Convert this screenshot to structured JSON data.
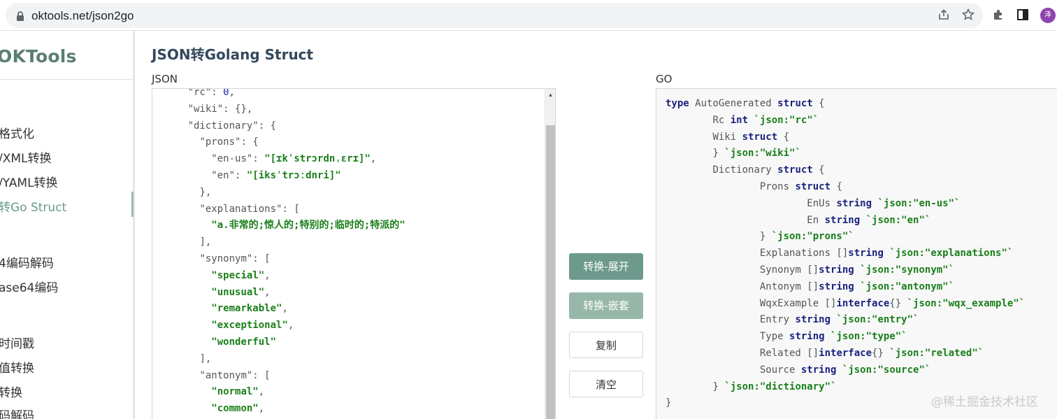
{
  "browser": {
    "url": "oktools.net/json2go",
    "avatar_initial": "泽",
    "icons": [
      "lock-icon",
      "share-icon",
      "star-icon",
      "extensions-icon",
      "sidepanel-icon"
    ]
  },
  "sidebar": {
    "logo": "OKTools",
    "items": [
      {
        "label": "格式化",
        "active": false
      },
      {
        "label": "/XML转换",
        "active": false
      },
      {
        "label": "/YAML转换",
        "active": false
      },
      {
        "label": "转Go Struct",
        "active": true
      },
      {
        "label": "4编码解码",
        "active": false
      },
      {
        "label": "ase64编码",
        "active": false
      },
      {
        "label": "时间戳",
        "active": false
      },
      {
        "label": "值转换",
        "active": false
      },
      {
        "label": "转换",
        "active": false
      },
      {
        "label": "码解码",
        "active": false
      }
    ]
  },
  "main": {
    "title": "JSON转Golang Struct",
    "json_label": "JSON",
    "go_label": "GO",
    "buttons": {
      "convert_expand": "转换-展开",
      "convert_nested": "转换-嵌套",
      "copy": "复制",
      "clear": "清空"
    },
    "json_lines": [
      {
        "indent": "  ",
        "key": "\"rc\"",
        "sep": ": ",
        "val": "0",
        "vt": "n",
        "tail": ","
      },
      {
        "indent": "  ",
        "key": "\"wiki\"",
        "sep": ": ",
        "val": "{}",
        "vt": "k",
        "tail": ","
      },
      {
        "indent": "  ",
        "key": "\"dictionary\"",
        "sep": ": ",
        "val": "{",
        "vt": "k",
        "tail": ""
      },
      {
        "indent": "    ",
        "key": "\"prons\"",
        "sep": ": ",
        "val": "{",
        "vt": "k",
        "tail": ""
      },
      {
        "indent": "      ",
        "key": "\"en-us\"",
        "sep": ": ",
        "val": "\"[ɪkˈstrɔrdnˌɛrɪ]\"",
        "vt": "s",
        "tail": ","
      },
      {
        "indent": "      ",
        "key": "\"en\"",
        "sep": ": ",
        "val": "\"[iksˈtrɔːdnri]\"",
        "vt": "s",
        "tail": ""
      },
      {
        "indent": "    ",
        "key": "",
        "sep": "",
        "val": "},",
        "vt": "k",
        "tail": ""
      },
      {
        "indent": "    ",
        "key": "\"explanations\"",
        "sep": ": ",
        "val": "[",
        "vt": "k",
        "tail": ""
      },
      {
        "indent": "      ",
        "key": "",
        "sep": "",
        "val": "\"a.非常的;惊人的;特别的;临时的;特派的\"",
        "vt": "s",
        "tail": ""
      },
      {
        "indent": "    ",
        "key": "",
        "sep": "",
        "val": "],",
        "vt": "k",
        "tail": ""
      },
      {
        "indent": "    ",
        "key": "\"synonym\"",
        "sep": ": ",
        "val": "[",
        "vt": "k",
        "tail": ""
      },
      {
        "indent": "      ",
        "key": "",
        "sep": "",
        "val": "\"special\"",
        "vt": "s",
        "tail": ","
      },
      {
        "indent": "      ",
        "key": "",
        "sep": "",
        "val": "\"unusual\"",
        "vt": "s",
        "tail": ","
      },
      {
        "indent": "      ",
        "key": "",
        "sep": "",
        "val": "\"remarkable\"",
        "vt": "s",
        "tail": ","
      },
      {
        "indent": "      ",
        "key": "",
        "sep": "",
        "val": "\"exceptional\"",
        "vt": "s",
        "tail": ","
      },
      {
        "indent": "      ",
        "key": "",
        "sep": "",
        "val": "\"wonderful\"",
        "vt": "s",
        "tail": ""
      },
      {
        "indent": "    ",
        "key": "",
        "sep": "",
        "val": "],",
        "vt": "k",
        "tail": ""
      },
      {
        "indent": "    ",
        "key": "\"antonym\"",
        "sep": ": ",
        "val": "[",
        "vt": "k",
        "tail": ""
      },
      {
        "indent": "      ",
        "key": "",
        "sep": "",
        "val": "\"normal\"",
        "vt": "s",
        "tail": ","
      },
      {
        "indent": "      ",
        "key": "",
        "sep": "",
        "val": "\"common\"",
        "vt": "s",
        "tail": ","
      }
    ],
    "go_lines": [
      {
        "indent": "",
        "parts": [
          [
            "kw",
            "type"
          ],
          [
            "p",
            " AutoGenerated "
          ],
          [
            "kw",
            "struct"
          ],
          [
            "p",
            " {"
          ]
        ]
      },
      {
        "indent": "\t",
        "parts": [
          [
            "p",
            "Rc "
          ],
          [
            "ty",
            "int"
          ],
          [
            "p",
            " "
          ],
          [
            "tag",
            "`json:\"rc\"`"
          ]
        ]
      },
      {
        "indent": "\t",
        "parts": [
          [
            "p",
            "Wiki "
          ],
          [
            "kw",
            "struct"
          ],
          [
            "p",
            " {"
          ]
        ]
      },
      {
        "indent": "\t",
        "parts": [
          [
            "p",
            "} "
          ],
          [
            "tag",
            "`json:\"wiki\"`"
          ]
        ]
      },
      {
        "indent": "\t",
        "parts": [
          [
            "p",
            "Dictionary "
          ],
          [
            "kw",
            "struct"
          ],
          [
            "p",
            " {"
          ]
        ]
      },
      {
        "indent": "\t\t",
        "parts": [
          [
            "p",
            "Prons "
          ],
          [
            "kw",
            "struct"
          ],
          [
            "p",
            " {"
          ]
        ]
      },
      {
        "indent": "\t\t\t",
        "parts": [
          [
            "p",
            "EnUs "
          ],
          [
            "ty",
            "string"
          ],
          [
            "p",
            " "
          ],
          [
            "tag",
            "`json:\"en-us\"`"
          ]
        ]
      },
      {
        "indent": "\t\t\t",
        "parts": [
          [
            "p",
            "En "
          ],
          [
            "ty",
            "string"
          ],
          [
            "p",
            " "
          ],
          [
            "tag",
            "`json:\"en\"`"
          ]
        ]
      },
      {
        "indent": "\t\t",
        "parts": [
          [
            "p",
            "} "
          ],
          [
            "tag",
            "`json:\"prons\"`"
          ]
        ]
      },
      {
        "indent": "\t\t",
        "parts": [
          [
            "p",
            "Explanations []"
          ],
          [
            "ty",
            "string"
          ],
          [
            "p",
            " "
          ],
          [
            "tag",
            "`json:\"explanations\"`"
          ]
        ]
      },
      {
        "indent": "\t\t",
        "parts": [
          [
            "p",
            "Synonym []"
          ],
          [
            "ty",
            "string"
          ],
          [
            "p",
            " "
          ],
          [
            "tag",
            "`json:\"synonym\"`"
          ]
        ]
      },
      {
        "indent": "\t\t",
        "parts": [
          [
            "p",
            "Antonym []"
          ],
          [
            "ty",
            "string"
          ],
          [
            "p",
            " "
          ],
          [
            "tag",
            "`json:\"antonym\"`"
          ]
        ]
      },
      {
        "indent": "\t\t",
        "parts": [
          [
            "p",
            "WqxExample []"
          ],
          [
            "ty",
            "interface"
          ],
          [
            "p",
            "{} "
          ],
          [
            "tag",
            "`json:\"wqx_example\"`"
          ]
        ]
      },
      {
        "indent": "\t\t",
        "parts": [
          [
            "p",
            "Entry "
          ],
          [
            "ty",
            "string"
          ],
          [
            "p",
            " "
          ],
          [
            "tag",
            "`json:\"entry\"`"
          ]
        ]
      },
      {
        "indent": "\t\t",
        "parts": [
          [
            "p",
            "Type "
          ],
          [
            "ty",
            "string"
          ],
          [
            "p",
            " "
          ],
          [
            "tag",
            "`json:\"type\"`"
          ]
        ]
      },
      {
        "indent": "\t\t",
        "parts": [
          [
            "p",
            "Related []"
          ],
          [
            "ty",
            "interface"
          ],
          [
            "p",
            "{} "
          ],
          [
            "tag",
            "`json:\"related\"`"
          ]
        ]
      },
      {
        "indent": "\t\t",
        "parts": [
          [
            "p",
            "Source "
          ],
          [
            "ty",
            "string"
          ],
          [
            "p",
            " "
          ],
          [
            "tag",
            "`json:\"source\"`"
          ]
        ]
      },
      {
        "indent": "\t",
        "parts": [
          [
            "p",
            "} "
          ],
          [
            "tag",
            "`json:\"dictionary\"`"
          ]
        ]
      },
      {
        "indent": "",
        "parts": [
          [
            "p",
            "}"
          ]
        ]
      }
    ]
  },
  "watermark": "@稀土掘金技术社区",
  "colors": {
    "accent": "#6d9a8c",
    "accent_light": "#97b8a9",
    "logo": "#5b7d72",
    "string": "#1a7f1a",
    "keyword": "#1a237e"
  }
}
